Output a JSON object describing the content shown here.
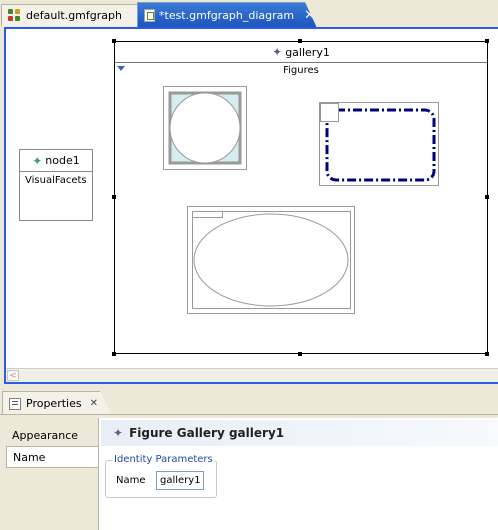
{
  "tabs": [
    {
      "label": "default.gmfgraph",
      "icon": "gmfgraph-file-icon",
      "active": false
    },
    {
      "label": "*test.gmfgraph_diagram",
      "icon": "diagram-file-icon",
      "active": true,
      "close_icon": "close-icon"
    }
  ],
  "diagram": {
    "node": {
      "name": "node1",
      "compartment": "VisualFacets",
      "icon": "node-icon"
    },
    "gallery": {
      "name": "gallery1",
      "compartment": "Figures",
      "icon": "figure-gallery-icon",
      "figures": [
        "rectangle-figure",
        "rounded-rectangle-figure",
        "ellipse-figure"
      ]
    }
  },
  "properties": {
    "view_title": "Properties",
    "view_icon": "properties-icon",
    "close_icon": "close-icon",
    "tabs": [
      {
        "label": "Appearance",
        "selected": false
      },
      {
        "label": "Name",
        "selected": true
      }
    ],
    "header_icon": "figure-gallery-icon",
    "header": "Figure Gallery gallery1",
    "group_title": "Identity Parameters",
    "field_label": "Name",
    "field_value": "gallery1"
  },
  "colors": {
    "active_tab": "#1c54bd",
    "selection_border": "#2b5ce1",
    "dash_figure": "#000080",
    "ellipse_fill": "#d7ecef",
    "group_title": "#1f4aa8"
  }
}
